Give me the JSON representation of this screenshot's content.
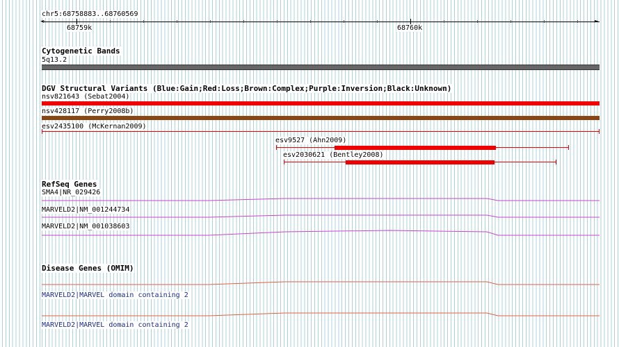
{
  "ruler": {
    "locus": "chr5:68758883..68760569",
    "tick_labels": [
      "68759k",
      "68760k"
    ]
  },
  "cyto": {
    "title": "Cytogenetic Bands",
    "band_label": "5q13.2",
    "color": "#666666"
  },
  "dgv": {
    "title": "DGV Structural Variants (Blue:Gain;Red:Loss;Brown:Complex;Purple:Inversion;Black:Unknown)",
    "variants": [
      {
        "label": "nsv821643 (Sebat2004)",
        "color": "#ee0000"
      },
      {
        "label": "nsv428117 (Perry2008b)",
        "color": "#8b4513"
      },
      {
        "label": "esv2435100 (McKernan2009)",
        "color": "#ee0000"
      },
      {
        "label": "esv9527 (Ahn2009)",
        "color": "#ee0000"
      },
      {
        "label": "esv2030621 (Bentley2008)",
        "color": "#ee0000"
      }
    ]
  },
  "refseq": {
    "title": "RefSeq Genes",
    "genes": [
      {
        "label": "SMA4|NR_029426"
      },
      {
        "label": "MARVELD2|NM_001244734"
      },
      {
        "label": "MARVELD2|NM_001038603"
      }
    ],
    "color": "#cc44cc"
  },
  "omim": {
    "title": "Disease Genes (OMIM)",
    "genes": [
      {
        "label": "MARVELD2|MARVEL domain containing 2"
      },
      {
        "label": "MARVELD2|MARVEL domain containing 2"
      }
    ],
    "color": "#e06040",
    "label_color": "#1a2a8a"
  }
}
